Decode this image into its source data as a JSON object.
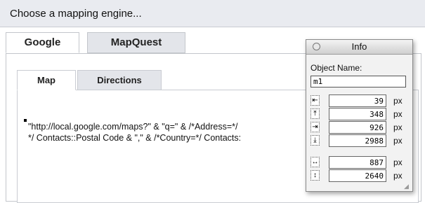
{
  "header": {
    "title": "Choose a mapping engine..."
  },
  "outer_tabs": [
    {
      "label": "Google",
      "active": true
    },
    {
      "label": "MapQuest",
      "active": false
    }
  ],
  "inner_tabs": [
    {
      "label": "Map",
      "active": true
    },
    {
      "label": "Directions",
      "active": false
    }
  ],
  "calculation": {
    "line1": "\"http://local.google.com/maps?\" & \"q=\" & /*Address=*/",
    "line1_tail": "\",\"",
    "line2": "*/ Contacts::Postal Code & \",\" & /*Country=*/ Contacts:"
  },
  "info_palette": {
    "title": "Info",
    "object_name_label": "Object Name:",
    "object_name_value": "m1",
    "fields": [
      {
        "icon": "left-edge-icon",
        "glyph": "⇤",
        "value": "39",
        "unit": "px"
      },
      {
        "icon": "top-edge-icon",
        "glyph": "⤒",
        "value": "348",
        "unit": "px"
      },
      {
        "icon": "right-edge-icon",
        "glyph": "⇥",
        "value": "926",
        "unit": "px"
      },
      {
        "icon": "bottom-edge-icon",
        "glyph": "⤓",
        "value": "2988",
        "unit": "px"
      },
      {
        "icon": "width-icon",
        "glyph": "↔",
        "value": "887",
        "unit": "px"
      },
      {
        "icon": "height-icon",
        "glyph": "↕",
        "value": "2640",
        "unit": "px"
      }
    ]
  }
}
